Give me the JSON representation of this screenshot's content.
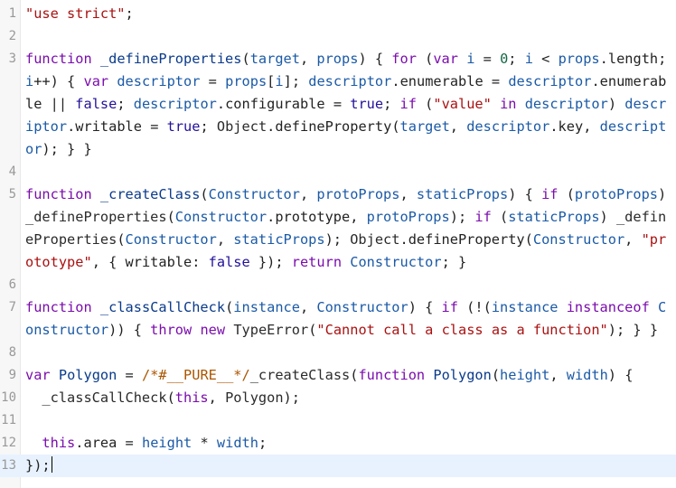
{
  "editor": {
    "colors": {
      "background": "#ffffff",
      "active_line": "#e8f2ff",
      "gutter": "#f7f7f7"
    },
    "lines": [
      {
        "number": "1",
        "tokens": [
          [
            "string",
            "\"use strict\""
          ],
          [
            "punct",
            ";"
          ]
        ]
      },
      {
        "number": "2",
        "tokens": []
      },
      {
        "number": "3",
        "tokens": [
          [
            "keyword",
            "function"
          ],
          [
            "punct",
            " "
          ],
          [
            "def",
            "_defineProperties"
          ],
          [
            "punct",
            "("
          ],
          [
            "variable-2",
            "target"
          ],
          [
            "punct",
            ", "
          ],
          [
            "variable-2",
            "props"
          ],
          [
            "punct",
            ") { "
          ],
          [
            "keyword",
            "for"
          ],
          [
            "punct",
            " ("
          ],
          [
            "keyword",
            "var"
          ],
          [
            "punct",
            " "
          ],
          [
            "variable-2",
            "i"
          ],
          [
            "punct",
            " "
          ],
          [
            "operator",
            "="
          ],
          [
            "punct",
            " "
          ],
          [
            "number",
            "0"
          ],
          [
            "punct",
            "; "
          ],
          [
            "variable-2",
            "i"
          ],
          [
            "punct",
            " "
          ],
          [
            "operator",
            "<"
          ],
          [
            "punct",
            " "
          ],
          [
            "variable-2",
            "props"
          ],
          [
            "punct",
            "."
          ],
          [
            "property",
            "length"
          ],
          [
            "punct",
            "; "
          ],
          [
            "variable-2",
            "i"
          ],
          [
            "operator",
            "++"
          ],
          [
            "punct",
            ") { "
          ],
          [
            "keyword",
            "var"
          ],
          [
            "punct",
            " "
          ],
          [
            "variable-2",
            "descriptor"
          ],
          [
            "punct",
            " "
          ],
          [
            "operator",
            "="
          ],
          [
            "punct",
            " "
          ],
          [
            "variable-2",
            "props"
          ],
          [
            "punct",
            "["
          ],
          [
            "variable-2",
            "i"
          ],
          [
            "punct",
            "]; "
          ],
          [
            "variable-2",
            "descriptor"
          ],
          [
            "punct",
            "."
          ],
          [
            "property",
            "enumerable"
          ],
          [
            "punct",
            " "
          ],
          [
            "operator",
            "="
          ],
          [
            "punct",
            " "
          ],
          [
            "variable-2",
            "descriptor"
          ],
          [
            "punct",
            "."
          ],
          [
            "property",
            "enumerable"
          ],
          [
            "punct",
            " "
          ],
          [
            "operator",
            "||"
          ],
          [
            "punct",
            " "
          ],
          [
            "atom",
            "false"
          ],
          [
            "punct",
            "; "
          ],
          [
            "variable-2",
            "descriptor"
          ],
          [
            "punct",
            "."
          ],
          [
            "property",
            "configurable"
          ],
          [
            "punct",
            " "
          ],
          [
            "operator",
            "="
          ],
          [
            "punct",
            " "
          ],
          [
            "atom",
            "true"
          ],
          [
            "punct",
            "; "
          ],
          [
            "keyword",
            "if"
          ],
          [
            "punct",
            " ("
          ],
          [
            "string",
            "\"value\""
          ],
          [
            "punct",
            " "
          ],
          [
            "keyword",
            "in"
          ],
          [
            "punct",
            " "
          ],
          [
            "variable-2",
            "descriptor"
          ],
          [
            "punct",
            ") "
          ],
          [
            "variable-2",
            "descriptor"
          ],
          [
            "punct",
            "."
          ],
          [
            "property",
            "writable"
          ],
          [
            "punct",
            " "
          ],
          [
            "operator",
            "="
          ],
          [
            "punct",
            " "
          ],
          [
            "atom",
            "true"
          ],
          [
            "punct",
            "; "
          ],
          [
            "variable",
            "Object"
          ],
          [
            "punct",
            "."
          ],
          [
            "property",
            "defineProperty"
          ],
          [
            "punct",
            "("
          ],
          [
            "variable-2",
            "target"
          ],
          [
            "punct",
            ", "
          ],
          [
            "variable-2",
            "descriptor"
          ],
          [
            "punct",
            "."
          ],
          [
            "property",
            "key"
          ],
          [
            "punct",
            ", "
          ],
          [
            "variable-2",
            "descriptor"
          ],
          [
            "punct",
            "); } }"
          ]
        ]
      },
      {
        "number": "4",
        "tokens": []
      },
      {
        "number": "5",
        "tokens": [
          [
            "keyword",
            "function"
          ],
          [
            "punct",
            " "
          ],
          [
            "def",
            "_createClass"
          ],
          [
            "punct",
            "("
          ],
          [
            "variable-2",
            "Constructor"
          ],
          [
            "punct",
            ", "
          ],
          [
            "variable-2",
            "protoProps"
          ],
          [
            "punct",
            ", "
          ],
          [
            "variable-2",
            "staticProps"
          ],
          [
            "punct",
            ") { "
          ],
          [
            "keyword",
            "if"
          ],
          [
            "punct",
            " ("
          ],
          [
            "variable-2",
            "protoProps"
          ],
          [
            "punct",
            ") "
          ],
          [
            "variable",
            "_defineProperties"
          ],
          [
            "punct",
            "("
          ],
          [
            "variable-2",
            "Constructor"
          ],
          [
            "punct",
            "."
          ],
          [
            "property",
            "prototype"
          ],
          [
            "punct",
            ", "
          ],
          [
            "variable-2",
            "protoProps"
          ],
          [
            "punct",
            "); "
          ],
          [
            "keyword",
            "if"
          ],
          [
            "punct",
            " ("
          ],
          [
            "variable-2",
            "staticProps"
          ],
          [
            "punct",
            ") "
          ],
          [
            "variable",
            "_defineProperties"
          ],
          [
            "punct",
            "("
          ],
          [
            "variable-2",
            "Constructor"
          ],
          [
            "punct",
            ", "
          ],
          [
            "variable-2",
            "staticProps"
          ],
          [
            "punct",
            "); "
          ],
          [
            "variable",
            "Object"
          ],
          [
            "punct",
            "."
          ],
          [
            "property",
            "defineProperty"
          ],
          [
            "punct",
            "("
          ],
          [
            "variable-2",
            "Constructor"
          ],
          [
            "punct",
            ", "
          ],
          [
            "string",
            "\"prototype\""
          ],
          [
            "punct",
            ", { "
          ],
          [
            "property",
            "writable"
          ],
          [
            "punct",
            ": "
          ],
          [
            "atom",
            "false"
          ],
          [
            "punct",
            " }); "
          ],
          [
            "keyword",
            "return"
          ],
          [
            "punct",
            " "
          ],
          [
            "variable-2",
            "Constructor"
          ],
          [
            "punct",
            "; }"
          ]
        ]
      },
      {
        "number": "6",
        "tokens": []
      },
      {
        "number": "7",
        "tokens": [
          [
            "keyword",
            "function"
          ],
          [
            "punct",
            " "
          ],
          [
            "def",
            "_classCallCheck"
          ],
          [
            "punct",
            "("
          ],
          [
            "variable-2",
            "instance"
          ],
          [
            "punct",
            ", "
          ],
          [
            "variable-2",
            "Constructor"
          ],
          [
            "punct",
            ") { "
          ],
          [
            "keyword",
            "if"
          ],
          [
            "punct",
            " (!("
          ],
          [
            "variable-2",
            "instance"
          ],
          [
            "punct",
            " "
          ],
          [
            "keyword",
            "instanceof"
          ],
          [
            "punct",
            " "
          ],
          [
            "variable-2",
            "Constructor"
          ],
          [
            "punct",
            ")) { "
          ],
          [
            "keyword",
            "throw"
          ],
          [
            "punct",
            " "
          ],
          [
            "keyword",
            "new"
          ],
          [
            "punct",
            " "
          ],
          [
            "variable",
            "TypeError"
          ],
          [
            "punct",
            "("
          ],
          [
            "string",
            "\"Cannot call a class as a function\""
          ],
          [
            "punct",
            "); } }"
          ]
        ]
      },
      {
        "number": "8",
        "tokens": []
      },
      {
        "number": "9",
        "tokens": [
          [
            "keyword",
            "var"
          ],
          [
            "punct",
            " "
          ],
          [
            "def",
            "Polygon"
          ],
          [
            "punct",
            " "
          ],
          [
            "operator",
            "="
          ],
          [
            "punct",
            " "
          ],
          [
            "comment",
            "/*#__PURE__*/"
          ],
          [
            "variable",
            "_createClass"
          ],
          [
            "punct",
            "("
          ],
          [
            "keyword",
            "function"
          ],
          [
            "punct",
            " "
          ],
          [
            "def",
            "Polygon"
          ],
          [
            "punct",
            "("
          ],
          [
            "variable-2",
            "height"
          ],
          [
            "punct",
            ", "
          ],
          [
            "variable-2",
            "width"
          ],
          [
            "punct",
            ") {"
          ]
        ]
      },
      {
        "number": "10",
        "tokens": [
          [
            "punct",
            "  "
          ],
          [
            "variable",
            "_classCallCheck"
          ],
          [
            "punct",
            "("
          ],
          [
            "keyword",
            "this"
          ],
          [
            "punct",
            ", "
          ],
          [
            "variable",
            "Polygon"
          ],
          [
            "punct",
            ");"
          ]
        ]
      },
      {
        "number": "11",
        "tokens": []
      },
      {
        "number": "12",
        "tokens": [
          [
            "punct",
            "  "
          ],
          [
            "keyword",
            "this"
          ],
          [
            "punct",
            "."
          ],
          [
            "property",
            "area"
          ],
          [
            "punct",
            " "
          ],
          [
            "operator",
            "="
          ],
          [
            "punct",
            " "
          ],
          [
            "variable-2",
            "height"
          ],
          [
            "punct",
            " "
          ],
          [
            "operator",
            "*"
          ],
          [
            "punct",
            " "
          ],
          [
            "variable-2",
            "width"
          ],
          [
            "punct",
            ";"
          ]
        ]
      },
      {
        "number": "13",
        "tokens": [
          [
            "punct",
            "});"
          ]
        ],
        "active": true,
        "cursor": true
      }
    ]
  }
}
